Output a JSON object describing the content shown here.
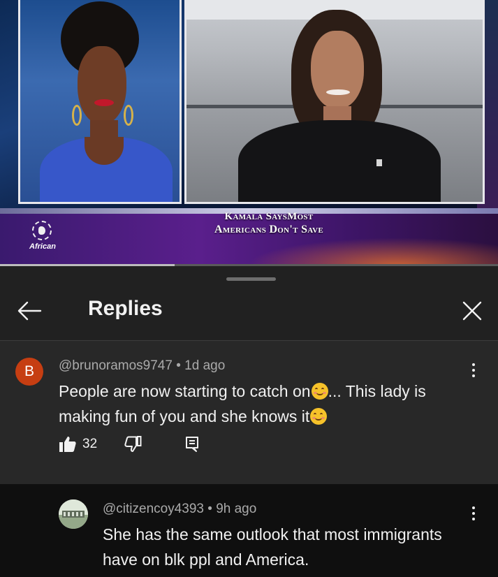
{
  "video": {
    "headline_line1": "Kamala SaysMost",
    "headline_line2": "Americans Don't Save",
    "channel_logo_text": "African",
    "progress_fraction": 0.35
  },
  "replies_panel": {
    "title": "Replies",
    "back_icon": "arrow-left-icon",
    "close_icon": "close-icon"
  },
  "comment": {
    "avatar_letter": "B",
    "avatar_color": "#c63e12",
    "author": "@brunoramos9747",
    "separator": "•",
    "time": "1d ago",
    "text_part1": "People are now starting to catch on",
    "text_part2": "... This lady is making fun of you and she knows it",
    "emoji": "smiling-face-emoji",
    "like_count": "32"
  },
  "reply": {
    "author": "@citizencoy4393",
    "separator": "•",
    "time": "9h ago",
    "text": "She has the same outlook that most immigrants have on blk ppl and America."
  },
  "colors": {
    "sheet_bg": "#212121",
    "highlighted_comment_bg": "#282828",
    "reply_bg": "#0f0f0f",
    "secondary_text": "#aaaaaa",
    "primary_text": "#f1f1f1"
  }
}
